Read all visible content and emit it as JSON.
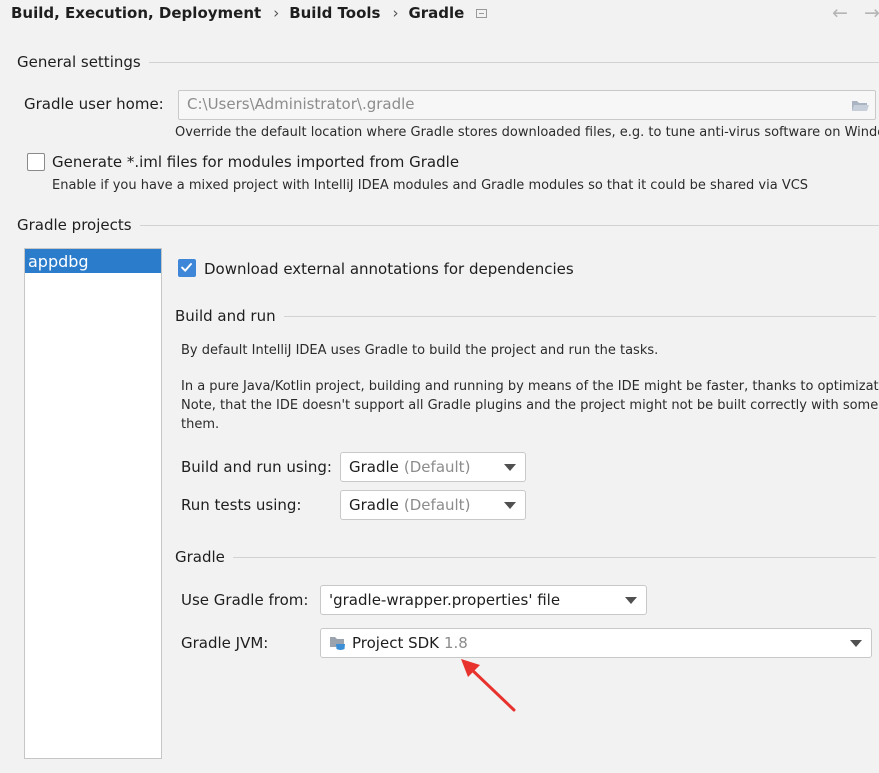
{
  "breadcrumb": {
    "items": [
      "Build, Execution, Deployment",
      "Build Tools",
      "Gradle"
    ],
    "separator": "›"
  },
  "nav": {
    "back": "←",
    "forward": "→"
  },
  "general": {
    "title": "General settings",
    "user_home_label": "Gradle user home:",
    "user_home_value": "C:\\Users\\Administrator\\.gradle",
    "user_home_hint": "Override the default location where Gradle stores downloaded files, e.g. to tune anti-virus software on Windows",
    "generate_iml_label": "Generate *.iml files for modules imported from Gradle",
    "generate_iml_checked": false,
    "generate_iml_hint": "Enable if you have a mixed project with IntelliJ IDEA modules and Gradle modules so that it could be shared via VCS"
  },
  "projects": {
    "title": "Gradle projects",
    "items": [
      "appdbg"
    ],
    "selected": "appdbg"
  },
  "settings": {
    "download_annotations_label": "Download external annotations for dependencies",
    "download_annotations_checked": true,
    "build_run": {
      "title": "Build and run",
      "desc1": "By default IntelliJ IDEA uses Gradle to build the project and run the tasks.",
      "desc2_line1": "In a pure Java/Kotlin project, building and running by means of the IDE might be faster, thanks to optimizations.",
      "desc2_line2": "Note, that the IDE doesn't support all Gradle plugins and the project might not be built correctly with some of",
      "desc2_line3": "them.",
      "build_using_label": "Build and run using:",
      "build_using_value": "Gradle",
      "build_using_suffix": "(Default)",
      "tests_using_label": "Run tests using:",
      "tests_using_value": "Gradle",
      "tests_using_suffix": "(Default)"
    },
    "gradle": {
      "title": "Gradle",
      "use_from_label": "Use Gradle from:",
      "use_from_value": "'gradle-wrapper.properties' file",
      "jvm_label": "Gradle JVM:",
      "jvm_value": "Project SDK",
      "jvm_version": "1.8"
    }
  },
  "colors": {
    "accent": "#3d86d8",
    "selection": "#2c7ccc",
    "annotation_arrow": "#e8322d"
  }
}
